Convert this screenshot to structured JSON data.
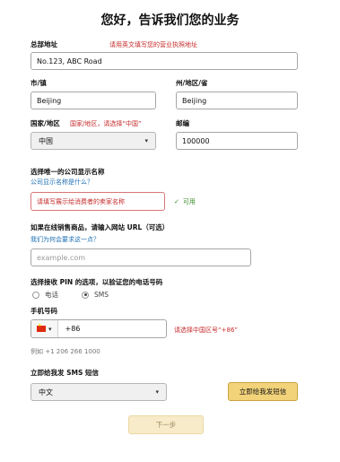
{
  "title": "您好，告诉我们您的业务",
  "address": {
    "label": "总部地址",
    "hint": "请用英文填写您的营业执照地址",
    "value": "No.123, ABC Road"
  },
  "city": {
    "label": "市/镇",
    "value": "Beijing"
  },
  "state": {
    "label": "州/地区/省",
    "value": "Beijing"
  },
  "country": {
    "label": "国家/地区",
    "hint": "国家/地区，请选择“中国”",
    "value": "中国"
  },
  "postal": {
    "label": "邮编",
    "value": "100000"
  },
  "display_name": {
    "label": "选择唯一的公司显示名称",
    "help_link": "公司显示名称是什么？",
    "value": "请填写展示给消费者的卖家名称",
    "status": "可用"
  },
  "website": {
    "label": "如果在线销售商品，请输入网站 URL（可选）",
    "help_link": "我们为何会要求这一点？",
    "placeholder": "example.com"
  },
  "pin": {
    "label": "选择接收 PIN 的选项，以验证您的电话号码",
    "options": [
      "电话",
      "SMS"
    ],
    "selected": "SMS"
  },
  "phone": {
    "label": "手机号码",
    "code": "+86",
    "hint": "请选择中国区号“+86”",
    "example": "例如 +1 206 266 1000"
  },
  "sms_language": {
    "label": "立即给我发 SMS 短信",
    "value": "中文",
    "button": "立即给我发短信"
  },
  "next_button": "下一步",
  "icons": {
    "check": "check-icon",
    "flag": "china-flag-icon",
    "caret": "chevron-down-icon"
  },
  "colors": {
    "hint_red": "#c62b2b",
    "link_blue": "#1f6fb2",
    "primary_yellow": "#f3d37a",
    "valid_green": "#3a8a2a"
  }
}
